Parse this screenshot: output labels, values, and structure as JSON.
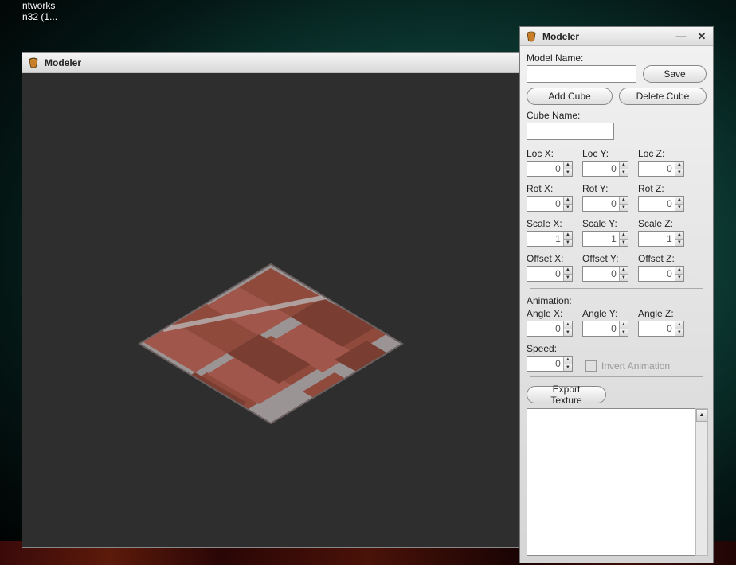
{
  "desktop": {
    "line1": "ntworks",
    "line2": "n32 (1..."
  },
  "viewport": {
    "title": "Modeler"
  },
  "panel": {
    "title": "Modeler",
    "modelNameLabel": "Model Name:",
    "modelNameValue": "",
    "saveLabel": "Save",
    "addCubeLabel": "Add Cube",
    "deleteCubeLabel": "Delete Cube",
    "cubeNameLabel": "Cube Name:",
    "cubeNameValue": "",
    "loc": {
      "x": {
        "label": "Loc X:",
        "value": "0"
      },
      "y": {
        "label": "Loc Y:",
        "value": "0"
      },
      "z": {
        "label": "Loc Z:",
        "value": "0"
      }
    },
    "rot": {
      "x": {
        "label": "Rot X:",
        "value": "0"
      },
      "y": {
        "label": "Rot Y:",
        "value": "0"
      },
      "z": {
        "label": "Rot Z:",
        "value": "0"
      }
    },
    "scale": {
      "x": {
        "label": "Scale X:",
        "value": "1"
      },
      "y": {
        "label": "Scale Y:",
        "value": "1"
      },
      "z": {
        "label": "Scale Z:",
        "value": "1"
      }
    },
    "offset": {
      "x": {
        "label": "Offset X:",
        "value": "0"
      },
      "y": {
        "label": "Offset Y:",
        "value": "0"
      },
      "z": {
        "label": "Offset Z:",
        "value": "0"
      }
    },
    "animationLabel": "Animation:",
    "angle": {
      "x": {
        "label": "Angle X:",
        "value": "0"
      },
      "y": {
        "label": "Angle Y:",
        "value": "0"
      },
      "z": {
        "label": "Angle Z:",
        "value": "0"
      }
    },
    "speedLabel": "Speed:",
    "speedValue": "0",
    "invertLabel": "Invert Animation",
    "exportLabel": "Export Texture"
  }
}
